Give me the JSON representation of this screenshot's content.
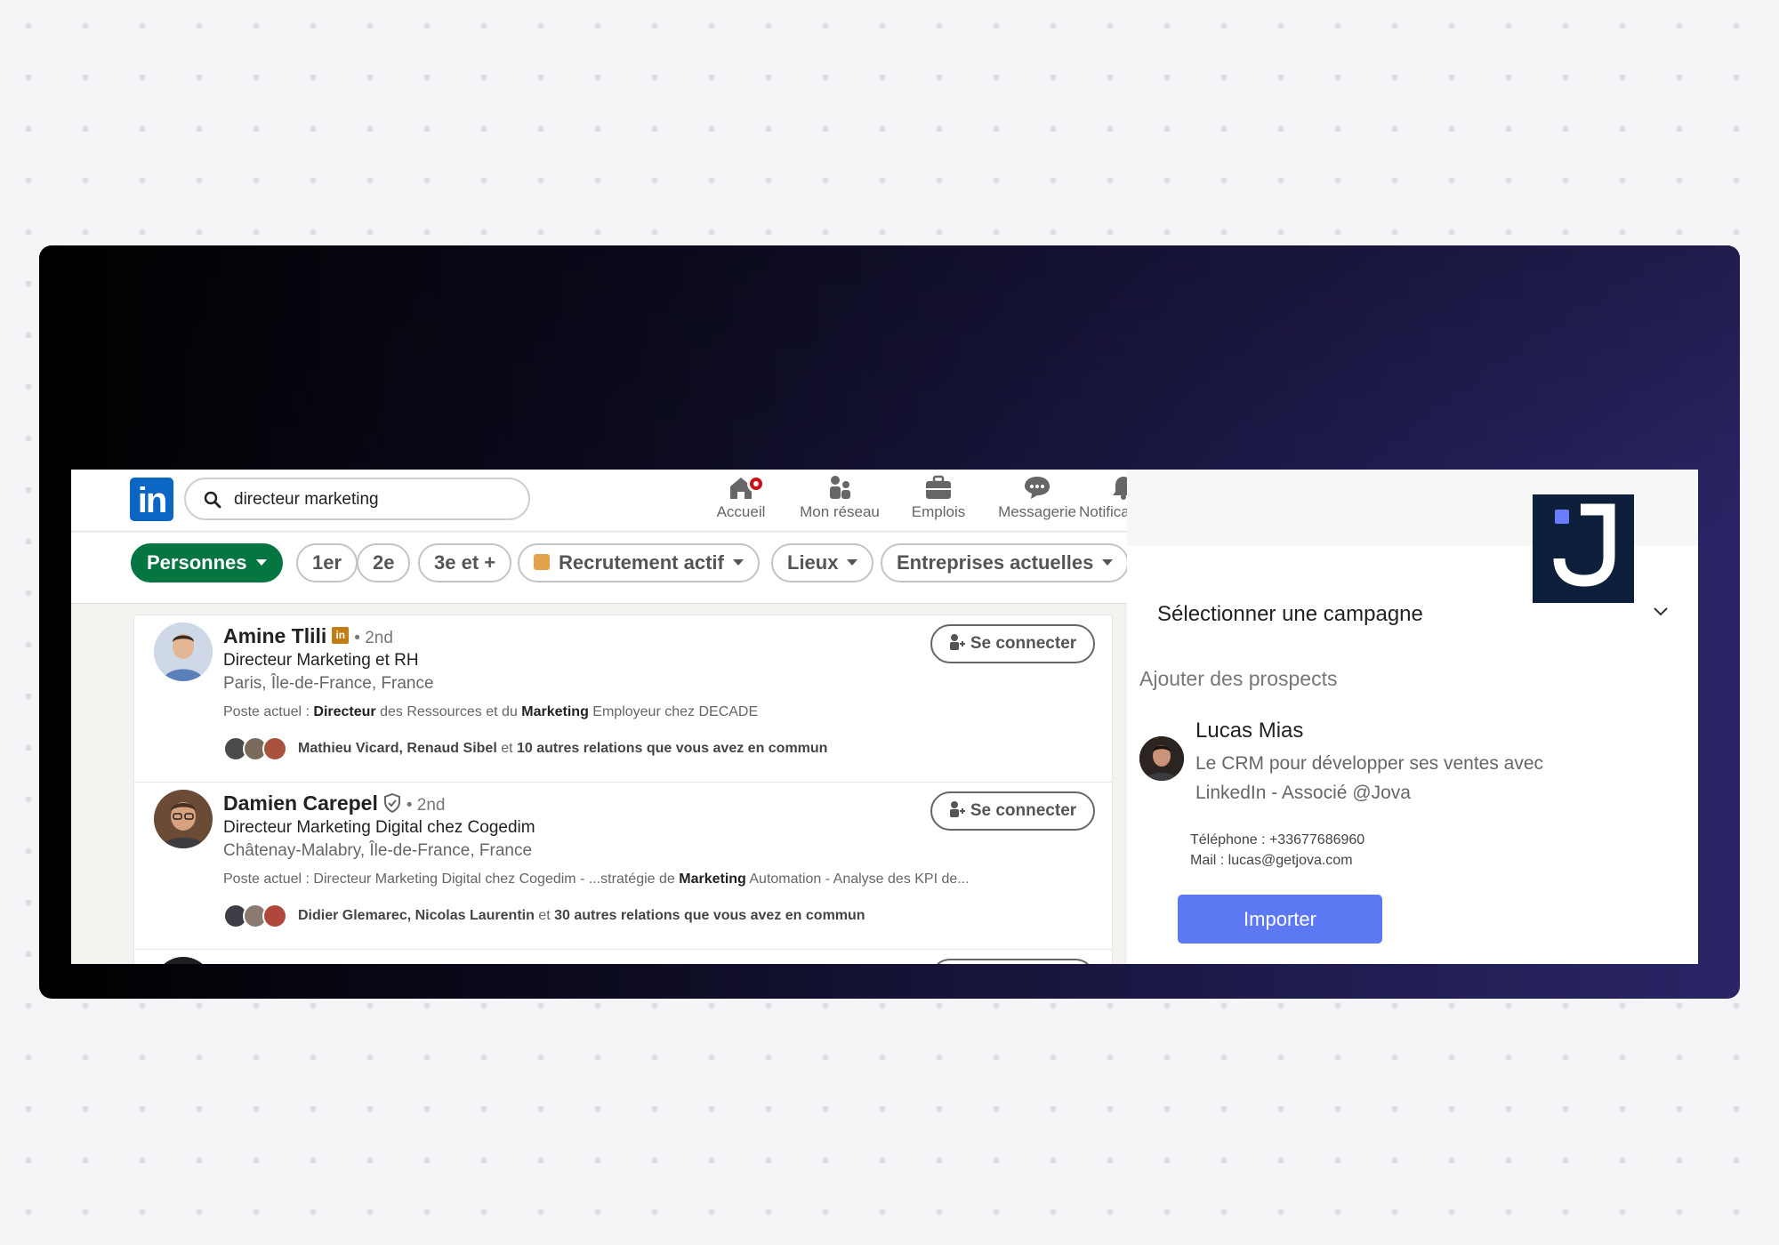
{
  "linkedin": {
    "logo_text": "in",
    "search": {
      "value": "directeur marketing"
    },
    "nav": [
      {
        "label": "Accueil",
        "icon": "home-icon"
      },
      {
        "label": "Mon réseau",
        "icon": "network-icon"
      },
      {
        "label": "Emplois",
        "icon": "briefcase-icon"
      },
      {
        "label": "Messagerie",
        "icon": "messaging-icon"
      },
      {
        "label": "Notifications",
        "icon": "bell-icon"
      }
    ],
    "filters": [
      {
        "label": "Personnes"
      },
      {
        "label": "1er"
      },
      {
        "label": "2e"
      },
      {
        "label": "3e et +"
      },
      {
        "label": "Recrutement actif"
      },
      {
        "label": "Lieux"
      },
      {
        "label": "Entreprises actuelles"
      }
    ],
    "results": [
      {
        "name": "Amine Tlili",
        "degree": "• 2nd",
        "headline": "Directeur Marketing et RH",
        "location": "Paris, Île-de-France, France",
        "poste_prefix": "Poste actuel : ",
        "poste_b1": "Directeur",
        "poste_mid": " des Ressources et du ",
        "poste_b2": "Marketing",
        "poste_suffix": " Employeur chez DECADE",
        "mutual_names": "Mathieu Vicard, Renaud Sibel",
        "mutual_mid": " et ",
        "mutual_count": "10 autres relations que vous avez en commun",
        "connect_label": "Se connecter"
      },
      {
        "name": "Damien Carepel",
        "degree": "• 2nd",
        "headline": "Directeur Marketing Digital chez Cogedim",
        "location": "Châtenay-Malabry, Île-de-France, France",
        "poste_prefix": "Poste actuel : Directeur Marketing Digital chez Cogedim - ...stratégie de ",
        "poste_b1": "Marketing",
        "poste_mid": " Automation - Analyse des KPI de...",
        "poste_b2": "",
        "poste_suffix": "",
        "mutual_names": "Didier Glemarec, Nicolas Laurentin",
        "mutual_mid": " et ",
        "mutual_count": "30 autres relations que vous avez en commun",
        "connect_label": "Se connecter"
      }
    ]
  },
  "jova": {
    "campaign_select": "Sélectionner une campagne",
    "add_prospects": "Ajouter des prospects",
    "lead": {
      "name": "Lucas Mias",
      "description": "Le CRM pour développer ses ventes avec LinkedIn - Associé @Jova",
      "phone": "Téléphone : +33677686960",
      "mail": "Mail : lucas@getjova.com"
    },
    "import_label": "Importer"
  },
  "colors": {
    "linkedin_blue": "#0a66c2",
    "filter_active_green": "#057642",
    "jova_button": "#5c78f2",
    "jova_logo_bg": "#0e1f3c",
    "notification_red": "#cc1016"
  }
}
